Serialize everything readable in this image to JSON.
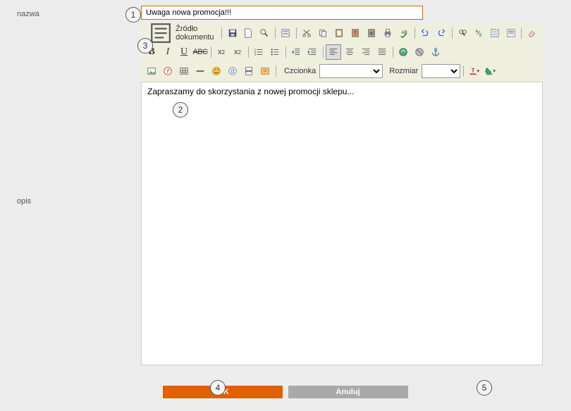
{
  "labels": {
    "name": "nazwa",
    "desc": "opis"
  },
  "name_input": {
    "value": "Uwaga nowa promocja!!!"
  },
  "toolbar": {
    "source_label": "Źródło dokumentu",
    "font_label": "Czcionka",
    "size_label": "Rozmiar",
    "strike_text": "ABC"
  },
  "editor": {
    "content": "Zapraszamy do skorzystania z nowej promocji sklepu..."
  },
  "buttons": {
    "ok": "OK",
    "cancel": "Anuluj"
  },
  "markers": {
    "m1": "1",
    "m2": "2",
    "m3": "3",
    "m4": "4",
    "m5": "5"
  }
}
